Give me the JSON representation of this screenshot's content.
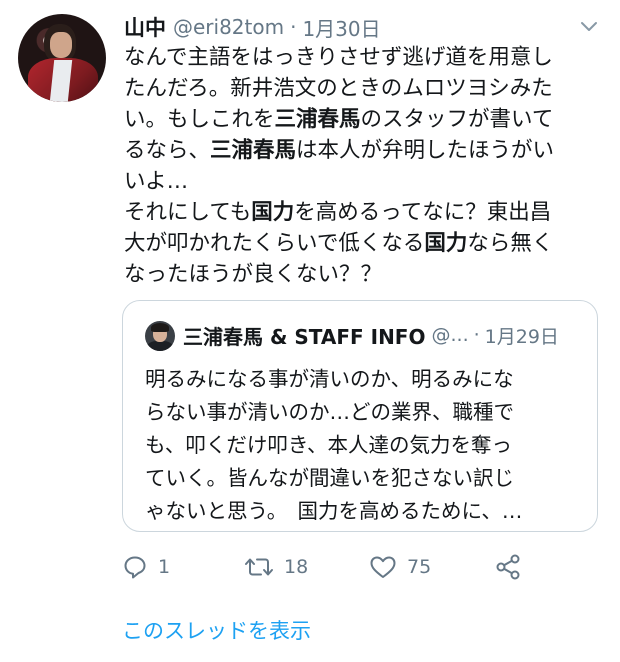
{
  "tweet": {
    "author_name": "山中",
    "handle": "@eri82tom",
    "separator": "·",
    "date": "1月30日",
    "text_lines": [
      [
        {
          "t": "なんで主語をはっきりさせず逃げ道を用意し",
          "b": false
        }
      ],
      [
        {
          "t": "たんだろ。新井浩文のときのムロツヨシみた",
          "b": false
        }
      ],
      [
        {
          "t": "い。もしこれを",
          "b": false
        },
        {
          "t": "三浦春馬",
          "b": true
        },
        {
          "t": "のスタッフが書いて",
          "b": false
        }
      ],
      [
        {
          "t": "るなら、",
          "b": false
        },
        {
          "t": "三浦春馬",
          "b": true
        },
        {
          "t": "は本人が弁明したほうがい",
          "b": false
        }
      ],
      [
        {
          "t": "いよ…",
          "b": false
        }
      ],
      [
        {
          "t": "それにしても",
          "b": false
        },
        {
          "t": "国力",
          "b": true
        },
        {
          "t": "を高めるってなに？東出昌",
          "b": false
        }
      ],
      [
        {
          "t": "大が叩かれたくらいで低くなる",
          "b": false
        },
        {
          "t": "国力",
          "b": true
        },
        {
          "t": "なら無く",
          "b": false
        }
      ],
      [
        {
          "t": "なったほうが良くない？？",
          "b": false
        }
      ]
    ]
  },
  "quoted_tweet": {
    "author_name": "三浦春馬 & STAFF INFO",
    "handle": "@...",
    "separator": "·",
    "date": "1月29日",
    "text_lines": [
      "明るみになる事が清いのか、明るみにな",
      "らない事が清いのか…どの業界、職種で",
      "も、叩くだけ叩き、本人達の気力を奪っ",
      "ていく。皆んなが間違いを犯さない訳じ",
      "ゃないと思う。　国力を高めるために、…"
    ]
  },
  "actions": {
    "reply": {
      "icon": "reply-icon",
      "count": "1"
    },
    "retweet": {
      "icon": "retweet-icon",
      "count": "18"
    },
    "like": {
      "icon": "heart-icon",
      "count": "75"
    },
    "share": {
      "icon": "share-icon"
    }
  },
  "thread_link": "このスレッドを表示",
  "colors": {
    "text": "#14171a",
    "secondary": "#657786",
    "link": "#1da1f2",
    "border": "#ccd6dd"
  }
}
